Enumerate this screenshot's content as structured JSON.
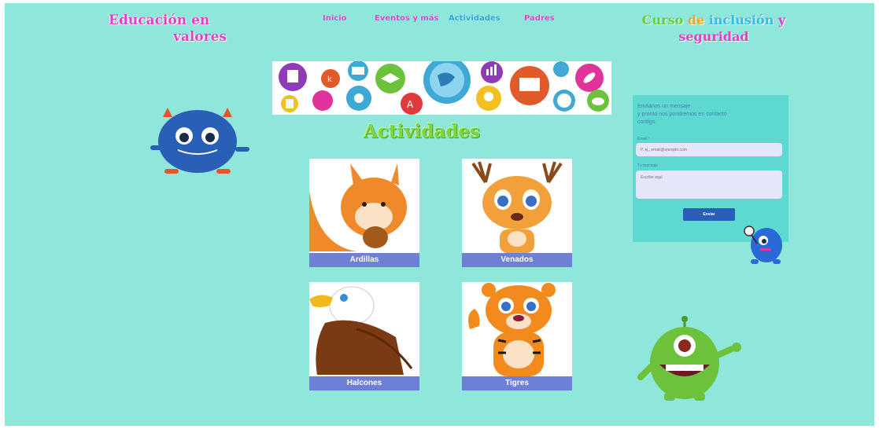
{
  "site": {
    "logo_line1": "Educación en",
    "logo_line2": "valores"
  },
  "nav": [
    {
      "label": "Inicio",
      "active": false
    },
    {
      "label": "Eventos y más",
      "active": false
    },
    {
      "label": "Actividades",
      "active": true
    },
    {
      "label": "Padres",
      "active": false
    }
  ],
  "course": {
    "words": [
      {
        "text": "Curso ",
        "color": "#5ed13a"
      },
      {
        "text": "de ",
        "color": "#f2a826"
      },
      {
        "text": "inclusión ",
        "color": "#3db7e4"
      },
      {
        "text": "y",
        "color": "#e040c8"
      }
    ],
    "line2": "seguridad",
    "line2_color": "#e040c8"
  },
  "banner": {
    "icons": [
      "robot-bubble-icon",
      "letter-bubble-icon",
      "mail-bubble-icon",
      "graduation-cap-bubble-icon",
      "globe-bubble-icon",
      "chart-bubble-icon",
      "monitor-bubble-icon",
      "question-bubble-icon",
      "rocket-bubble-icon",
      "id-card-bubble-icon",
      "pencil-bubble-icon",
      "gears-bubble-icon",
      "a-letter-bubble-icon",
      "lightbulb-bubble-icon",
      "soccer-ball-bubble-icon",
      "cloud-bubble-icon"
    ]
  },
  "main": {
    "title": "Actividades",
    "cards": [
      {
        "caption": "Ardillas",
        "image": "squirrel-illustration"
      },
      {
        "caption": "Venados",
        "image": "deer-illustration"
      },
      {
        "caption": "Halcones",
        "image": "eagle-illustration"
      },
      {
        "caption": "Tigres",
        "image": "tiger-illustration"
      }
    ]
  },
  "contact": {
    "intro_line1": "Envíanos un mensaje",
    "intro_line2": "y pronto nos pondremos en contacto",
    "intro_line3": "contigo.",
    "email_label": "Email *",
    "email_placeholder": "P. ej., email@ejemplo.com",
    "message_label": "Tu mensaje",
    "message_placeholder": "Escribe aquí",
    "submit_label": "Enviar"
  },
  "colors": {
    "background": "#8fe6db",
    "accent_pink": "#e040c8",
    "caption_bar": "#6e7fd6",
    "form_bg": "#5dd9d2",
    "button": "#2a5fb8"
  }
}
